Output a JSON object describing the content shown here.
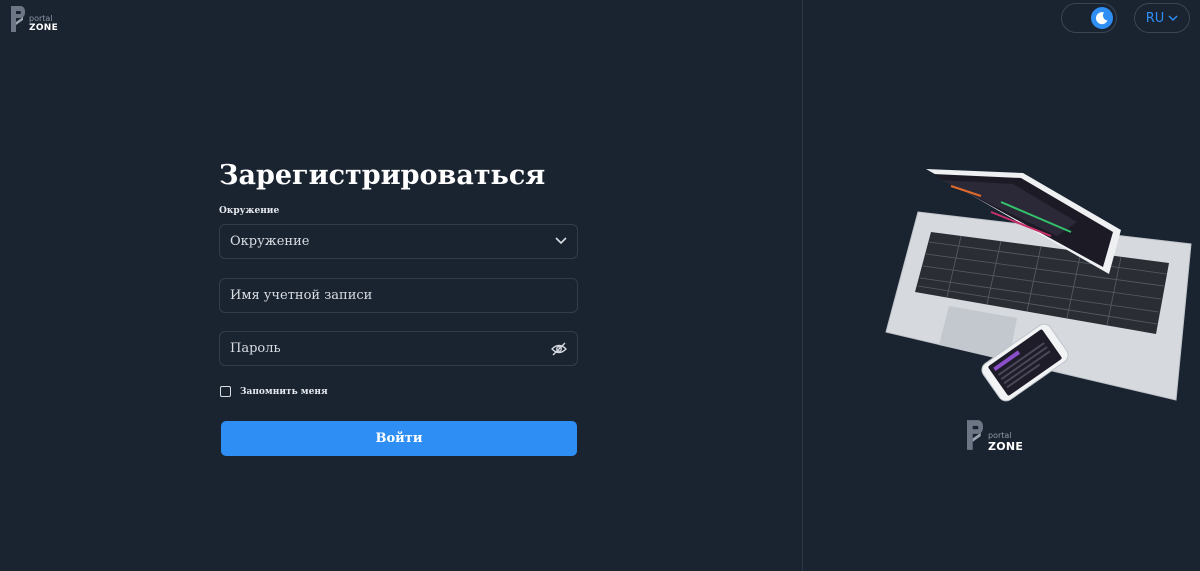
{
  "brand": {
    "small": "portal",
    "big": "ZONE"
  },
  "header": {
    "theme_toggle": {
      "state": "dark",
      "icon": "moon-icon"
    },
    "language": {
      "value": "RU",
      "icon": "chevron-down-icon"
    }
  },
  "form": {
    "title": "Зарегистрироваться",
    "environment_label": "Окружение",
    "environment_value": "Окружение",
    "username_placeholder": "Имя учетной записи",
    "password_placeholder": "Пароль",
    "password_icon": "eye-off-icon",
    "remember_label": "Запомнить меня",
    "remember_checked": false,
    "submit_label": "Войти"
  },
  "colors": {
    "background": "#1a2330",
    "accent": "#2f8ef4",
    "border": "#323d4c",
    "divider": "#2c3847"
  }
}
